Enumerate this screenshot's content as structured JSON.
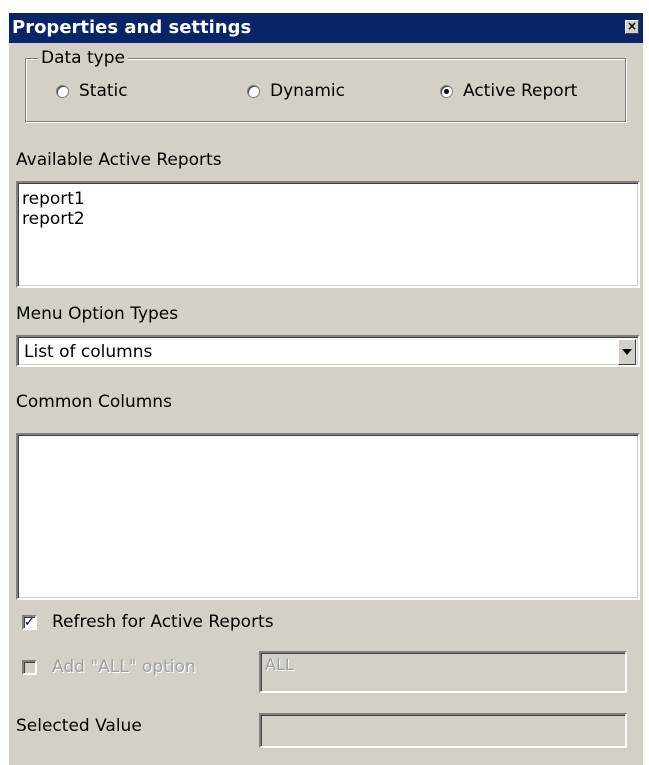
{
  "title": "Properties and settings",
  "data_type": {
    "legend": "Data type",
    "options": [
      {
        "label": "Static",
        "selected": false
      },
      {
        "label": "Dynamic",
        "selected": false
      },
      {
        "label": "Active Report",
        "selected": true
      }
    ]
  },
  "available_reports": {
    "label": "Available Active Reports",
    "items": [
      "report1",
      "report2"
    ]
  },
  "menu_option_types": {
    "label": "Menu Option Types",
    "value": "List of columns"
  },
  "common_columns": {
    "label": "Common Columns",
    "items": []
  },
  "refresh": {
    "label": "Refresh for Active Reports",
    "checked": true
  },
  "add_all": {
    "label": "Add \"ALL\" option",
    "checked": false,
    "enabled": false,
    "value": "ALL"
  },
  "selected_value": {
    "label": "Selected Value",
    "value": ""
  }
}
